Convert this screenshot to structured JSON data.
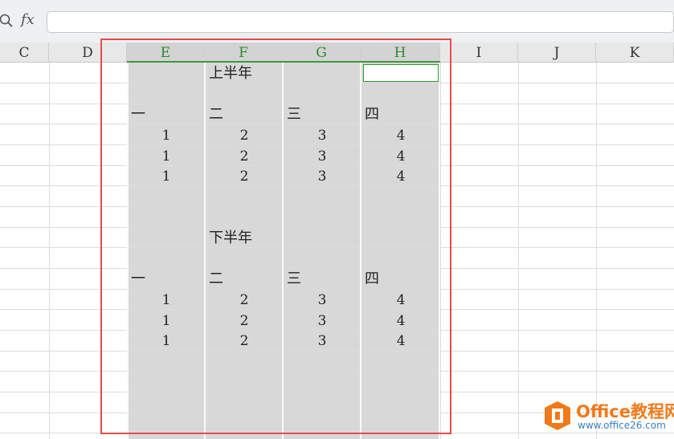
{
  "formula_bar": {
    "fx_label": "fx",
    "value": ""
  },
  "columns": [
    {
      "label": "C",
      "selected": false
    },
    {
      "label": "D",
      "selected": false
    },
    {
      "label": "E",
      "selected": true
    },
    {
      "label": "F",
      "selected": true
    },
    {
      "label": "G",
      "selected": true
    },
    {
      "label": "H",
      "selected": true
    },
    {
      "label": "I",
      "selected": false
    },
    {
      "label": "J",
      "selected": false
    },
    {
      "label": "K",
      "selected": false
    }
  ],
  "sheet": {
    "block1": {
      "title": "上半年",
      "headers": [
        "一",
        "二",
        "三",
        "四"
      ],
      "rows": [
        [
          "1",
          "2",
          "3",
          "4"
        ],
        [
          "1",
          "2",
          "3",
          "4"
        ],
        [
          "1",
          "2",
          "3",
          "4"
        ]
      ]
    },
    "block2": {
      "title": "下半年",
      "headers": [
        "一",
        "二",
        "三",
        "四"
      ],
      "rows": [
        [
          "1",
          "2",
          "3",
          "4"
        ],
        [
          "1",
          "2",
          "3",
          "4"
        ],
        [
          "1",
          "2",
          "3",
          "4"
        ]
      ]
    }
  },
  "colors": {
    "selection_green": "#2f9a2f",
    "highlight_red": "#e44c4c",
    "selected_fill": "#d8d8d8"
  },
  "watermark": {
    "title": "Office教程网",
    "url": "www.office26.com"
  }
}
